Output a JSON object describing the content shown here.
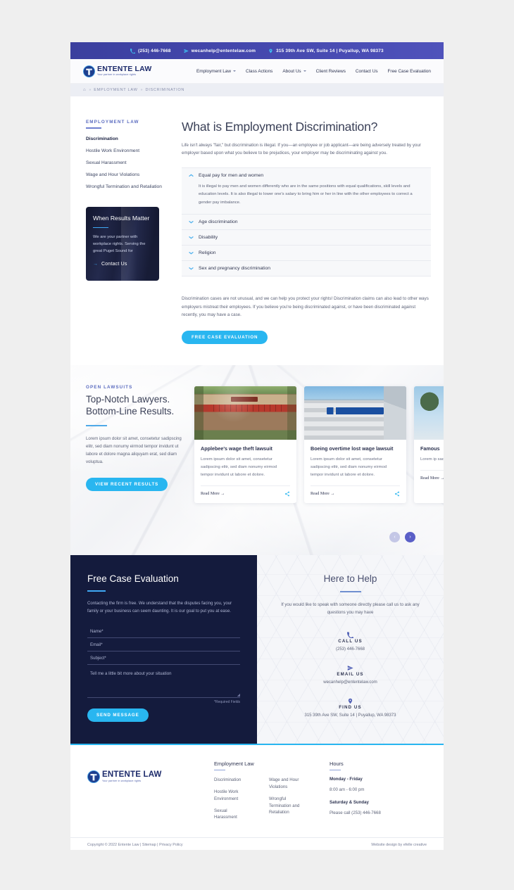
{
  "topbar": {
    "phone": "(253) 446-7668",
    "email": "wecanhelp@ententelaw.com",
    "address": "315 39th Ave SW, Suite 14  |  Puyallup, WA  98373"
  },
  "brand": {
    "name": "ENTENTE LAW",
    "tagline": "Your partner in workplace rights"
  },
  "nav": {
    "items": [
      {
        "label": "Employment Law",
        "has_dropdown": true
      },
      {
        "label": "Class Actions",
        "has_dropdown": false
      },
      {
        "label": "About Us",
        "has_dropdown": true
      },
      {
        "label": "Client Reviews",
        "has_dropdown": false
      },
      {
        "label": "Contact Us",
        "has_dropdown": false
      },
      {
        "label": "Free Case Evaluation",
        "has_dropdown": false
      }
    ]
  },
  "breadcrumb": {
    "home_icon": "home-icon",
    "sep": "»",
    "items": [
      "EMPLOYMENT LAW",
      "DISCRIMINATION"
    ]
  },
  "sidebar": {
    "kicker": "EMPLOYMENT LAW",
    "links": [
      "Discrimination",
      "Hostile Work Environment",
      "Sexual Harassment",
      "Wage and Hour Violations",
      "Wrongful Termination and Retaliation"
    ],
    "promo": {
      "title": "When Results Matter",
      "text": "We are your partner with workplace rights. Serving the great Puget Sound for",
      "cta": "Contact Us",
      "arrow": "→"
    }
  },
  "article": {
    "title": "What is Employment Discrimination?",
    "lede": "Life isn't always \"fair,\" but discrimination is illegal. If you—an employee or job applicant—are being adversely treated by your employer based upon what you believe to be prejudices, your employer may be discriminating against you.",
    "accordion": [
      {
        "label": "Equal pay for men and women",
        "open": true,
        "body": "It is illegal to pay men and women differently who are in the same positions with equal qualifications, skill levels and education levels. It is also illegal to lower one's salary to bring him or her in line with the other employees to correct a gender pay imbalance."
      },
      {
        "label": "Age discrimination",
        "open": false,
        "body": ""
      },
      {
        "label": "Disability",
        "open": false,
        "body": ""
      },
      {
        "label": "Religion",
        "open": false,
        "body": ""
      },
      {
        "label": "Sex and pregnancy discrimination",
        "open": false,
        "body": ""
      }
    ],
    "outro": "Discrimination cases are not unusual, and we can help you protect your rights! Discrimination claims can also lead to other ways employers mistreat their employees. If you believe you're being discriminated against, or have been discriminated against recently, you may have a case.",
    "cta": "FREE CASE EVALUATION"
  },
  "lawsuits": {
    "kicker": "OPEN LAWSUITS",
    "heading_line1": "Top-Notch Lawyers.",
    "heading_line2": "Bottom-Line Results.",
    "text": "Lorem ipsum dolor sit amet, consetetur sadipscing elitr, sed diam nonumy eirmod tempor invidunt ut labore et dolore magna aliquyam erat, sed diam voluptua.",
    "cta": "VIEW RECENT RESULTS",
    "read_more": "Read More",
    "read_more_arrow": "→",
    "cards": [
      {
        "image": "applebees-storefront-photo",
        "title": "Applebee's wage theft lawsuit",
        "text": "Lorem ipsum dolor sit amet, consetetur sadipscing elitr, sed diam nonumy eirmod tempor invidunt ut labore et dolore."
      },
      {
        "image": "boeing-building-photo",
        "title": "Boeing overtime lost wage lawsuit",
        "text": "Lorem ipsum dolor sit amet, consetetur sadipscing elitr, sed diam nonumy eirmod tempor invidunt ut labore et dolore."
      },
      {
        "image": "street-scene-photo",
        "title": "Famous",
        "text": "Lorem ip sadipsci tempor i"
      }
    ],
    "carousel": {
      "prev": "‹",
      "next": "›"
    }
  },
  "evaluation": {
    "title": "Free Case Evaluation",
    "text": "Contacting the firm is free. We understand that the disputes facing you, your family or your business can seem daunting. It is our goal to put you at ease.",
    "fields": [
      {
        "placeholder": "Name*",
        "value": ""
      },
      {
        "placeholder": "Email*",
        "value": ""
      },
      {
        "placeholder": "Subject*",
        "value": ""
      }
    ],
    "textarea_placeholder": "Tell me a little bit more about your situation",
    "required_note": "*Required Fields",
    "submit": "SEND MESSAGE"
  },
  "help": {
    "title": "Here to Help",
    "text": "If you would like to speak with someone directly please call us to ask any questions you may have",
    "blocks": [
      {
        "icon": "phone-icon",
        "label": "CALL US",
        "value": "(253) 446-7668"
      },
      {
        "icon": "send-icon",
        "label": "EMAIL US",
        "value": "wecanhelp@ententelaw.com"
      },
      {
        "icon": "location-pin-icon",
        "label": "FIND US",
        "value": "315 39th Ave SW, Suite 14  |  Puyallup, WA  98373"
      }
    ]
  },
  "footer": {
    "col_title": "Employment Law",
    "links_a": [
      "Discrimination",
      "Hostile Work Environment",
      "Sexual Harassment"
    ],
    "links_b": [
      "Wage and Hour Violations",
      "Wrongful Termination and Retaliation"
    ],
    "hours_title": "Hours",
    "hours": [
      {
        "days": "Monday - Friday",
        "time": "8:00 am - 6:00 pm"
      },
      {
        "days": "Saturday & Sunday",
        "time": "Please call (253) 446-7668"
      }
    ],
    "copyright": "Copyright © 2022 Entente Law  |  Sitemap  |  Privacy Policy",
    "credit": "Website design by efelle creative"
  },
  "colors": {
    "topbar": "#4346ab",
    "accent_blue": "#29b6f0",
    "navy": "#141b3d",
    "brand_navy": "#1d2b6b",
    "carousel_next": "#5a5fc7"
  }
}
